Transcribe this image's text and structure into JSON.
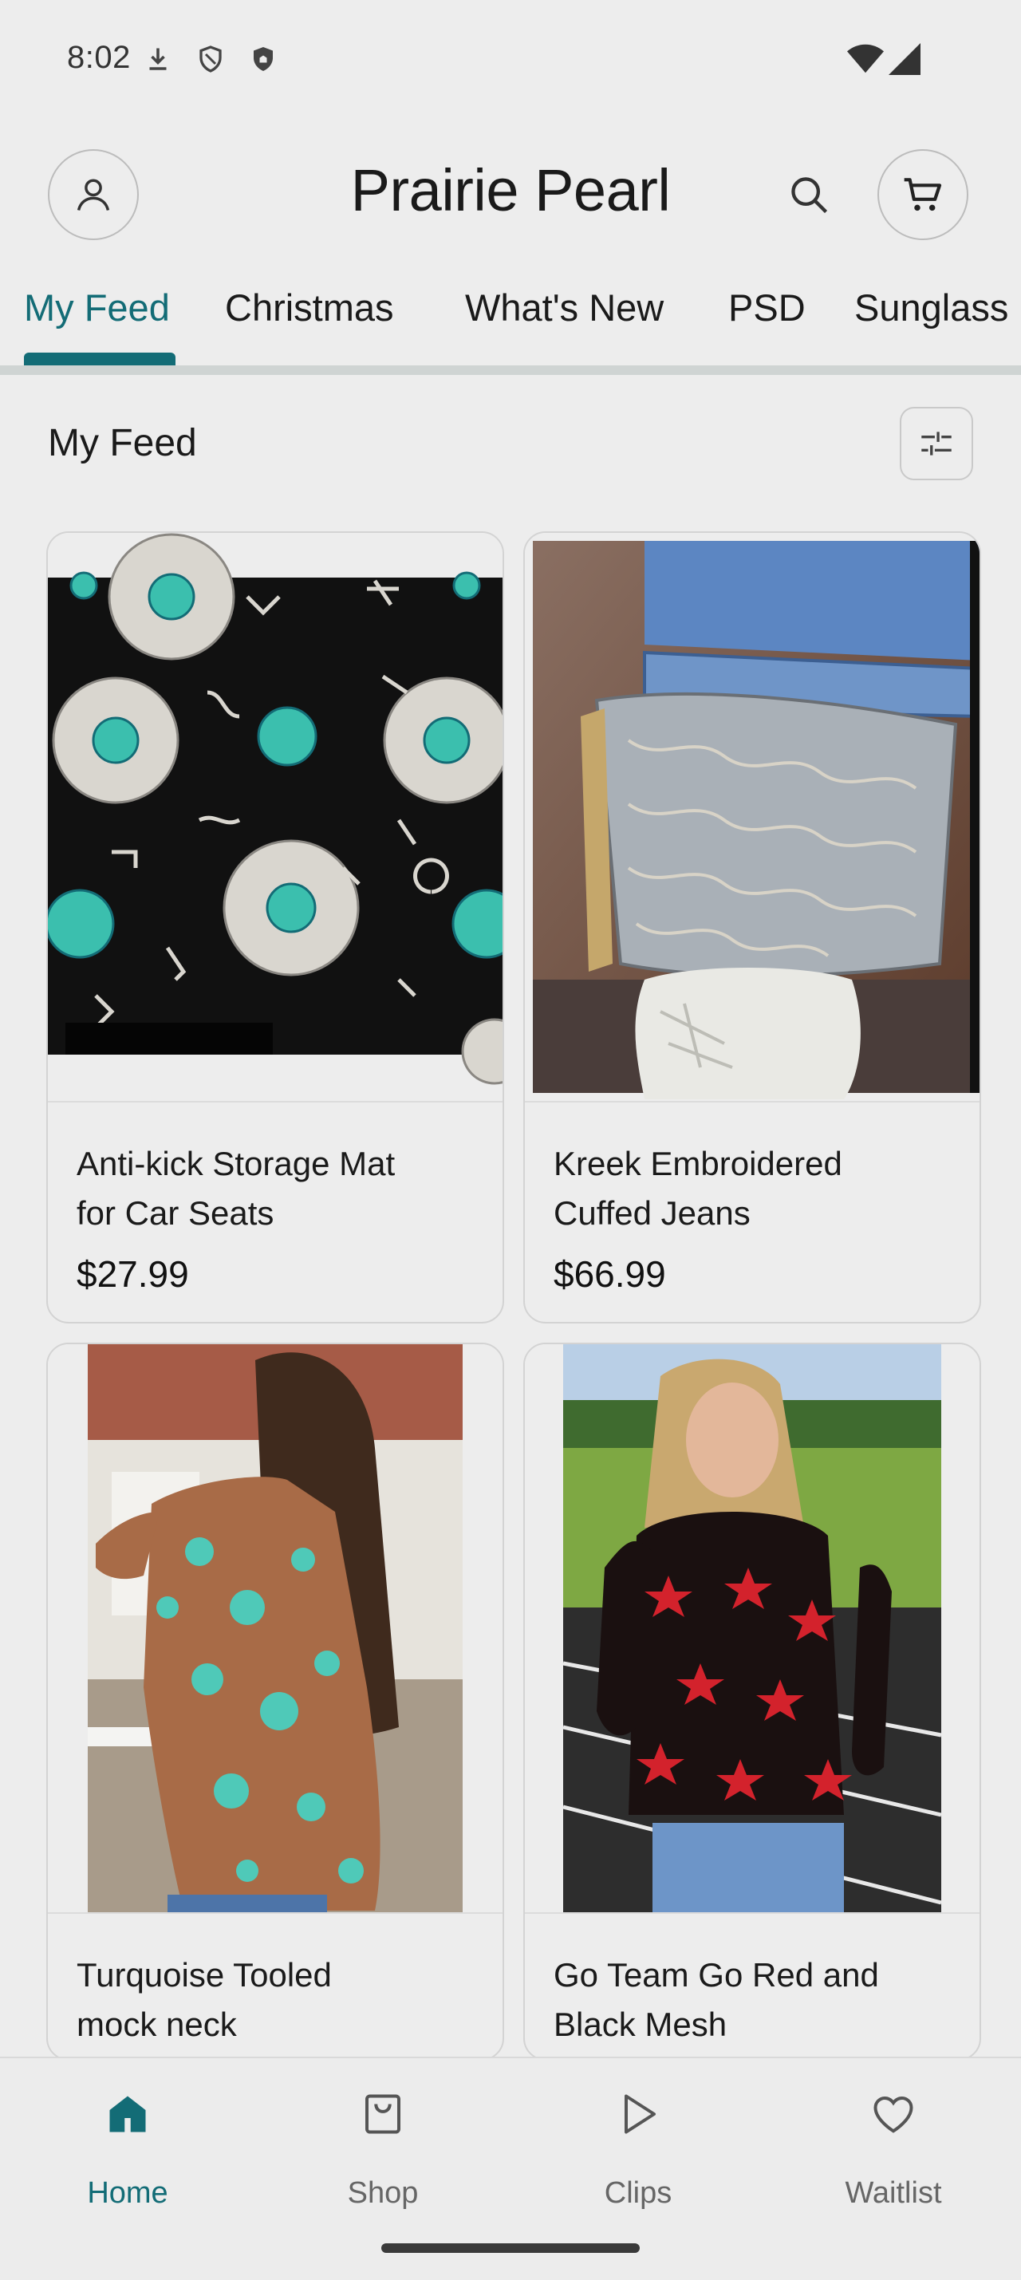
{
  "status_bar": {
    "time": "8:02",
    "left_icons": [
      "download-icon",
      "shield-outline-icon",
      "shield-filled-icon"
    ],
    "right_icons": [
      "wifi-icon",
      "cellular-signal-icon"
    ]
  },
  "header": {
    "title": "Prairie Pearl",
    "left_icon": "account-icon",
    "right_icons": [
      "search-icon",
      "cart-icon"
    ]
  },
  "tabs": [
    {
      "label": "My Feed",
      "active": true
    },
    {
      "label": "Christmas",
      "active": false
    },
    {
      "label": "What's New",
      "active": false
    },
    {
      "label": "PSD",
      "active": false
    },
    {
      "label": "Sunglass",
      "active": false
    }
  ],
  "feed": {
    "heading": "My Feed",
    "filter_icon": "filter-sliders-icon"
  },
  "products": [
    {
      "name_line1": "Anti-kick Storage Mat",
      "name_line2": "for Car Seats",
      "price": "$27.99"
    },
    {
      "name_line1": "Kreek Embroidered",
      "name_line2": "Cuffed Jeans",
      "price": "$66.99"
    },
    {
      "name_line1": "Turquoise Tooled",
      "name_line2": "mock neck",
      "price": ""
    },
    {
      "name_line1": "Go Team Go Red and",
      "name_line2": "Black Mesh",
      "price": ""
    }
  ],
  "bottom_nav": [
    {
      "label": "Home",
      "icon": "home-icon",
      "active": true
    },
    {
      "label": "Shop",
      "icon": "shopping-bag-icon",
      "active": false
    },
    {
      "label": "Clips",
      "icon": "play-icon",
      "active": false
    },
    {
      "label": "Waitlist",
      "icon": "heart-icon",
      "active": false
    }
  ],
  "colors": {
    "accent": "#136c76",
    "background": "#ededed"
  }
}
